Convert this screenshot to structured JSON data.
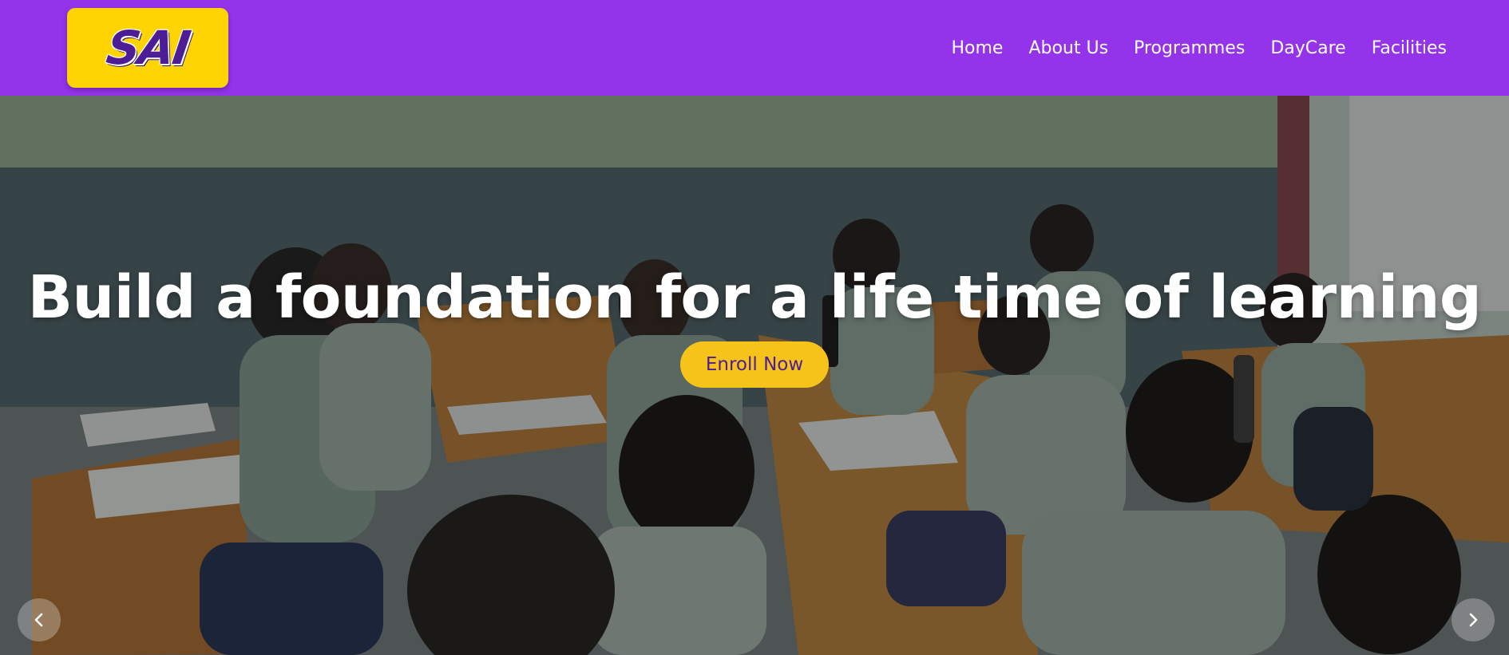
{
  "brand": {
    "logo_text": "SAI",
    "logo_bg": "#ffd400",
    "logo_fg": "#4c1d95"
  },
  "nav": {
    "bg": "#9333ea",
    "items": [
      {
        "label": "Home"
      },
      {
        "label": "About Us"
      },
      {
        "label": "Programmes"
      },
      {
        "label": "DayCare"
      },
      {
        "label": "Facilities"
      }
    ]
  },
  "hero": {
    "title": "Build a foundation for a life time of learning",
    "cta_label": "Enroll Now",
    "cta_bg": "#f6c31a",
    "prev_icon": "chevron-left-icon",
    "next_icon": "chevron-right-icon"
  }
}
